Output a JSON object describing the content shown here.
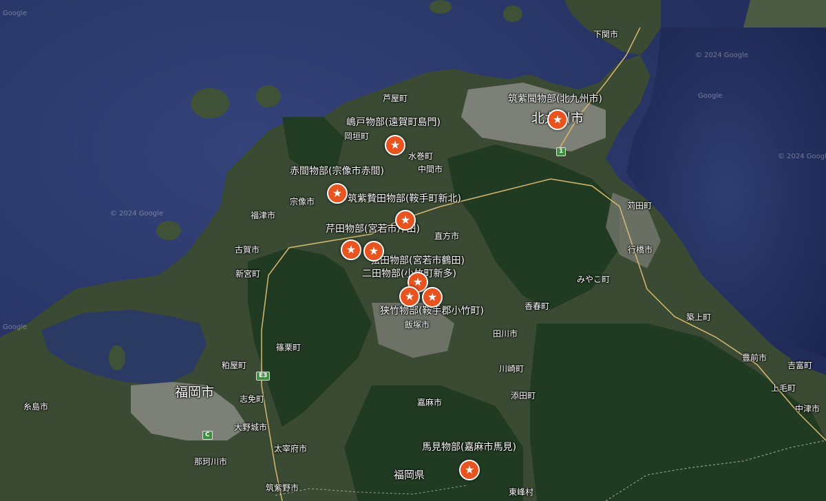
{
  "map": {
    "colors": {
      "sea": "#2a3868",
      "land": "#3a4a33",
      "forest": "#1f3a21",
      "urban": "#8f8f88",
      "marker": "#e85420",
      "road": "#d8b970"
    },
    "city_labels": {
      "shimonoseki": "下関市",
      "ashiya": "芦屋町",
      "okagaki": "岡垣町",
      "mizumaki": "水巻町",
      "nakama": "中間市",
      "munakata": "宗像市",
      "fukutsu": "福津市",
      "koga": "古賀市",
      "shingu": "新宮町",
      "nogata": "直方市",
      "kanda": "苅田町",
      "yukuhashi": "行橋市",
      "miyako": "みやこ町",
      "kawara": "香春町",
      "chikujo": "築上町",
      "iizuka": "飯塚市",
      "tagawa": "田川市",
      "sasaguri": "篠栗町",
      "kasuya": "粕屋町",
      "shime": "志免町",
      "kawasaki": "川崎町",
      "buzen": "豊前市",
      "yoshitomi": "吉富町",
      "itoshima": "糸島市",
      "kama": "嘉麻市",
      "soeda": "添田町",
      "kamige": "上毛町",
      "onojo": "大野城市",
      "dazaifu": "太宰府市",
      "nakagawa": "那珂川市",
      "chikushino": "筑紫野市",
      "toho": "東峰村",
      "nakatsu": "中津市"
    },
    "major_labels": {
      "fukuoka_city": "福岡市",
      "kitakyushu_city": "北九州市",
      "fukuoka_pref": "福岡県"
    },
    "place_labels": {
      "chikushi_kikumonobe": "筑紫聞物部(北九州市)",
      "shimato": "嶋戸物部(遠賀町島門)",
      "akama": "赤間物部(宗像市赤間)",
      "chikushi_nukata": "筑紫贄田物部(鞍手町新北)",
      "serita": "芹田物部(宮若市芹田)",
      "tsuruta": "弦田物部(宮若市鶴田)",
      "futata": "二田物部(小竹町新多)",
      "sasetake": "狭竹物部(鞍手郡小竹町)",
      "mami": "馬見物部(嘉麻市馬見)"
    },
    "road_shields": {
      "e3": "E3",
      "c": "C",
      "one": "1"
    },
    "watermark": "© 2024 Google",
    "brand": "Google",
    "marker_icon": "star-icon"
  }
}
